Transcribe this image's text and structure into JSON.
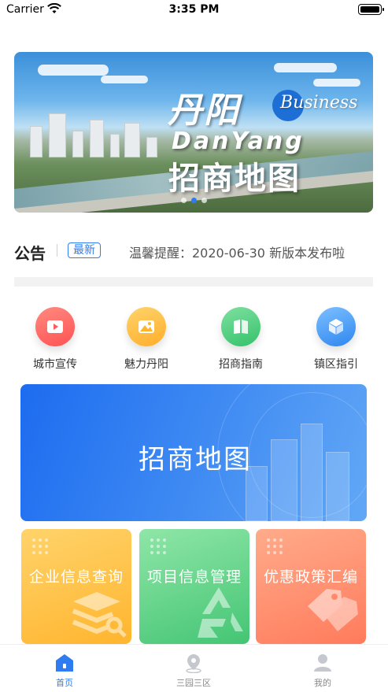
{
  "status_bar": {
    "carrier": "Carrier",
    "time": "3:35 PM"
  },
  "banner": {
    "city_name": "丹阳",
    "roman": "DanYang",
    "business": "Business",
    "subtitle": "招商地图",
    "slide_count": 3,
    "active_slide": 1
  },
  "notice": {
    "title": "公告",
    "badge": "最新",
    "text": "温馨提醒：2020-06-30 新版本发布啦"
  },
  "quick_menu": [
    {
      "label": "城市宣传",
      "icon": "video-icon",
      "color_from": "#ff8a80",
      "color_to": "#ff5252"
    },
    {
      "label": "魅力丹阳",
      "icon": "landscape-icon",
      "color_from": "#ffd36b",
      "color_to": "#ffae2b"
    },
    {
      "label": "招商指南",
      "icon": "book-icon",
      "color_from": "#7fe0a0",
      "color_to": "#34c26a"
    },
    {
      "label": "镇区指引",
      "icon": "cube-icon",
      "color_from": "#7cc0ff",
      "color_to": "#2f86f0"
    }
  ],
  "main_card": {
    "title": "招商地图"
  },
  "tiles": [
    {
      "title": "企业信息查询",
      "icon": "search-layers-icon",
      "color_from": "#ffd36b",
      "color_to": "#ffb52e"
    },
    {
      "title": "项目信息管理",
      "icon": "recycle-icon",
      "color_from": "#8fe6a7",
      "color_to": "#44c574"
    },
    {
      "title": "优惠政策汇编",
      "icon": "tag-icon",
      "color_from": "#ffab8a",
      "color_to": "#ff7b5c"
    }
  ],
  "tab_bar": [
    {
      "label": "首页",
      "icon": "home-icon",
      "active": true
    },
    {
      "label": "三园三区",
      "icon": "location-icon",
      "active": false
    },
    {
      "label": "我的",
      "icon": "user-icon",
      "active": false
    }
  ],
  "colors": {
    "accent": "#2f7cf0",
    "text_primary": "#222222",
    "text_secondary": "#555555"
  }
}
